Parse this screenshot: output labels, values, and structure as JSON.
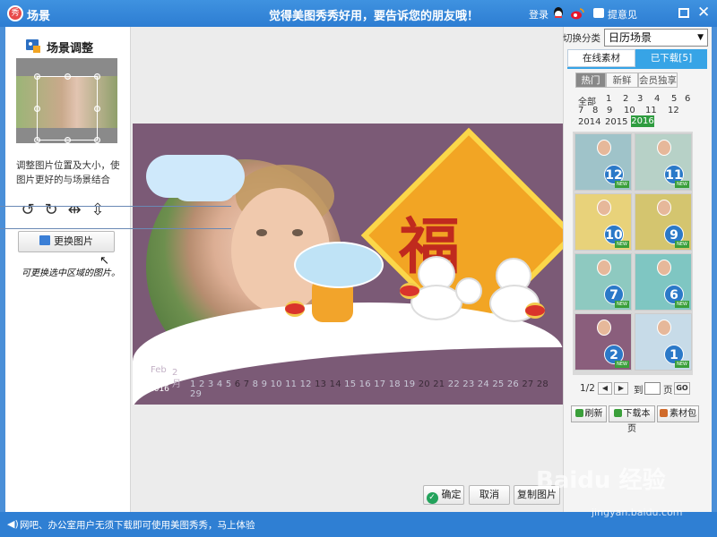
{
  "titlebar": {
    "app_logo": "秀",
    "title": "场景",
    "slogan": "觉得美图秀秀好用，要告诉您的朋友哦！",
    "login": "登录",
    "feedback": "提意见",
    "close": "✕"
  },
  "left_panel": {
    "heading": "场景调整",
    "tip": "调整图片位置及大小，使图片更好的与场景结合",
    "change_button": "更换图片",
    "handwritten_note": "可更换选中区域的图片。",
    "note_arrow": "↖"
  },
  "scene": {
    "fu_char": "福",
    "month_en": "Feb",
    "month_num": "2",
    "month_cn": "月",
    "year": "2016",
    "days": [
      "1",
      "2",
      "3",
      "4",
      "5",
      "6",
      "7",
      "8",
      "9",
      "10",
      "11",
      "12",
      "13",
      "14",
      "15",
      "16",
      "17",
      "18",
      "19",
      "20",
      "21",
      "22",
      "23",
      "24",
      "25",
      "26",
      "27",
      "28",
      "29"
    ],
    "highlighted_days": [
      "6",
      "7",
      "13",
      "14",
      "20",
      "21",
      "27",
      "28"
    ]
  },
  "bottom_buttons": {
    "confirm": "确定",
    "cancel": "取消",
    "copy_image": "复制图片"
  },
  "right_panel": {
    "switch_label": "切换分类",
    "select_value": "日历场景",
    "tab_online": "在线素材",
    "tab_downloaded": "已下载[5]",
    "segments": [
      "热门",
      "新鲜",
      "会员独享"
    ],
    "filter_all": "全部",
    "months": [
      "1",
      "2",
      "3",
      "4",
      "5",
      "6",
      "7",
      "8",
      "9",
      "10",
      "11",
      "12"
    ],
    "years": [
      "2014",
      "2015",
      "2016"
    ],
    "tiles": [
      "12",
      "11",
      "10",
      "9",
      "7",
      "6",
      "2",
      "1"
    ],
    "tile_new_label": "NEW",
    "page_indicator": "1/2",
    "goto_label": "到",
    "page_label": "页",
    "go_button": "GO",
    "refresh": "刷新",
    "download_page": "下载本页",
    "material_pack": "素材包"
  },
  "statusbar": {
    "text": "网吧、办公室用户无须下载即可使用美图秀秀，马上体验"
  },
  "watermark": {
    "text": "Baidu 经验",
    "url": "jingyan.baidu.com"
  },
  "colors": {
    "titlebar": "#3f92e0",
    "accent_tab": "#37a4e6",
    "scene_bg": "#7b5a76",
    "year_selected": "#2e9c3f"
  }
}
